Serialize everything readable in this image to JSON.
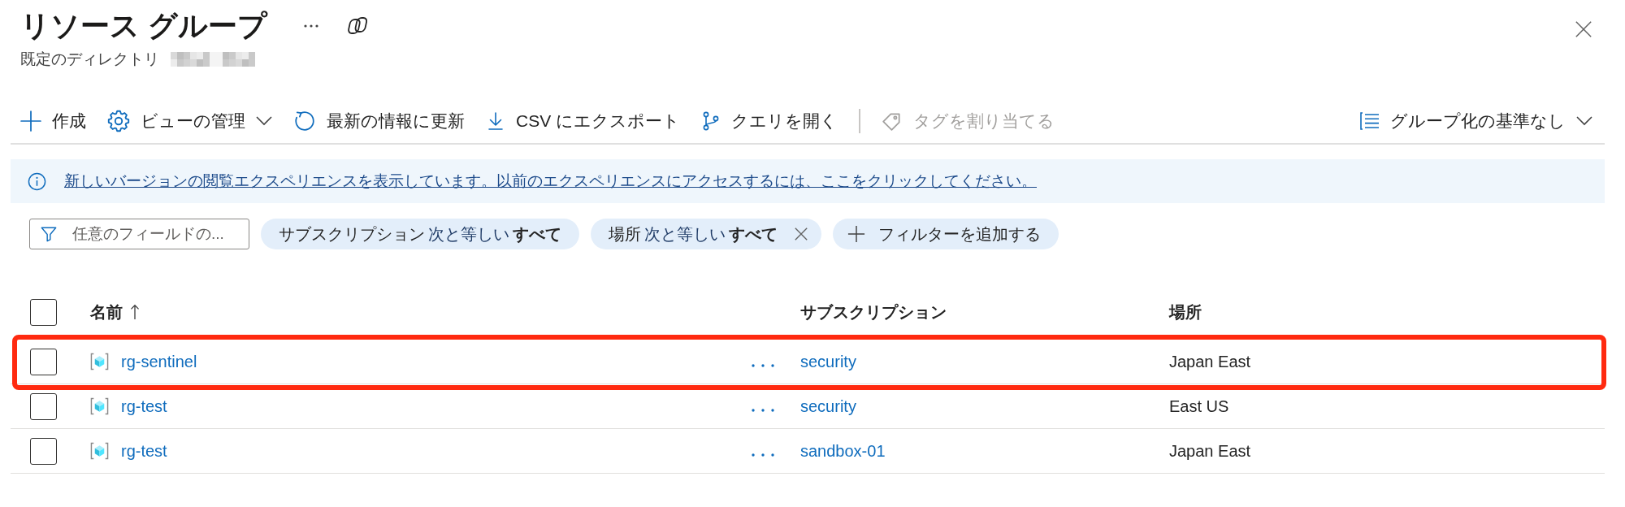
{
  "header": {
    "title": "リソース グループ",
    "subtitle": "既定のディレクトリ",
    "subtitle_redacted": true
  },
  "toolbar": {
    "actions": [
      {
        "kind": "create",
        "label": "作成",
        "dropdown": false,
        "disabled": false
      },
      {
        "kind": "view",
        "label": "ビューの管理",
        "dropdown": true,
        "disabled": false
      },
      {
        "kind": "refresh",
        "label": "最新の情報に更新",
        "dropdown": false,
        "disabled": false
      },
      {
        "kind": "export",
        "label": "CSV にエクスポート",
        "dropdown": false,
        "disabled": false
      },
      {
        "kind": "query",
        "label": "クエリを開く",
        "dropdown": false,
        "disabled": false
      }
    ],
    "tag_actions": [
      {
        "kind": "tag",
        "label": "タグを割り当てる",
        "dropdown": false,
        "disabled": true
      }
    ],
    "group_by": {
      "label": "グループ化の基準なし"
    }
  },
  "notice": {
    "message": "新しいバージョンの閲覧エクスペリエンスを表示しています。以前のエクスペリエンスにアクセスするには、ここをクリックしてください。"
  },
  "filters": {
    "search_placeholder": "任意のフィールドの...",
    "pills": [
      {
        "field": "サブスクリプション",
        "operator": "次と等しい",
        "value": "すべて",
        "removable": false
      },
      {
        "field": "場所",
        "operator": "次と等しい",
        "value": "すべて",
        "removable": true
      }
    ],
    "add_label": "フィルターを追加する"
  },
  "table": {
    "all_selected": false,
    "columns": [
      {
        "label": "名前",
        "sorted": true
      },
      {
        "label": "サブスクリプション",
        "sorted": false
      },
      {
        "label": "場所",
        "sorted": false
      }
    ],
    "rows": [
      {
        "name": "rg-sentinel",
        "subscription": "security",
        "location": "Japan East",
        "selected": false,
        "highlighted": true
      },
      {
        "name": "rg-test",
        "subscription": "security",
        "location": "East US",
        "selected": false,
        "highlighted": false
      },
      {
        "name": "rg-test",
        "subscription": "sandbox-01",
        "location": "Japan East",
        "selected": false,
        "highlighted": false
      }
    ]
  }
}
